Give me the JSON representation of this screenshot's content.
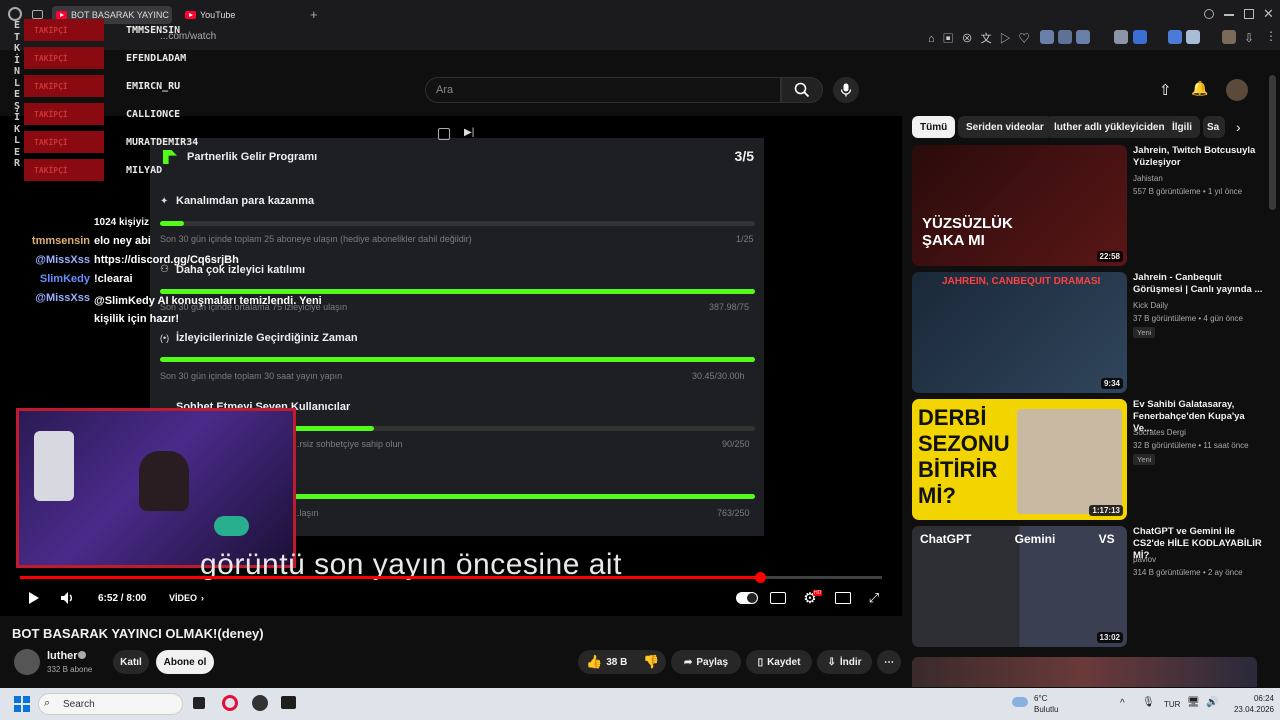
{
  "browser": {
    "tabs": [
      {
        "label": "BOT BASARAK YAYINC"
      },
      {
        "label": "YouTube"
      }
    ],
    "address": "...com/watch",
    "new_tab": "+"
  },
  "masthead": {
    "search_placeholder": "Ara"
  },
  "overlay": {
    "vertical_letters": [
      "E",
      "T",
      "K",
      "İ",
      "N",
      "L",
      "E",
      "Ş",
      "İ",
      "K",
      "L",
      "E",
      "R"
    ],
    "followers": [
      {
        "tag": "TAKİPÇİ",
        "name": "TMMSENSIN"
      },
      {
        "tag": "TAKİPÇİ",
        "name": "EFENDLADAM"
      },
      {
        "tag": "TAKİPÇİ",
        "name": "EMIRCN_RU"
      },
      {
        "tag": "TAKİPÇİ",
        "name": "CALLIONCE"
      },
      {
        "tag": "TAKİPÇİ",
        "name": "MURATDEMIR34"
      },
      {
        "tag": "TAKİPÇİ",
        "name": "MILYAD"
      }
    ],
    "chat": [
      {
        "user": "",
        "msg": "1024 kişiyiz",
        "color": "#ffffff"
      },
      {
        "user": "tmmsensin",
        "msg": "elo ney abi",
        "color": "#e0b070"
      },
      {
        "user": "@MissXss",
        "msg": "https://discord.gg/Cq6srjBh",
        "color": "#9ab0ff"
      },
      {
        "user": "SlimKedy",
        "msg": "!clearai",
        "color": "#6a8cff"
      },
      {
        "user": "@MissXss",
        "msg": "@SlimKedy AI konuşmaları temizlendi. Yeni kişilik için hazır!",
        "color": "#9ab0ff"
      }
    ],
    "subtitle": "görüntü son yayın öncesine ait"
  },
  "partner": {
    "title": "Partnerlik Gelir Programı",
    "count": "3/5",
    "sections": [
      {
        "heading": "Kanalımdan para kazanma",
        "desc": "Son 30 gün içinde toplam 25 aboneye ulaşın (hediye abonelikler dahil değildir)",
        "value": "1/25",
        "fill": 0.04
      },
      {
        "heading": "Daha çok izleyici katılımı",
        "desc": "Son 30 gün içinde ortalama 75 izleyiciye ulaşın",
        "value": "387.98/75",
        "fill": 1.0
      },
      {
        "heading": "İzleyicilerinizle Geçirdiğiniz Zaman",
        "desc": "Son 30 gün içinde toplam 30 saat yayın yapın",
        "value": "30.45/30.00h",
        "fill": 1.0
      },
      {
        "heading": "Sohbet Etmeyi Seven Kullanıcılar",
        "desc": "...rsiz sohbetçiye sahip olun",
        "value": "90/250",
        "fill": 0.36
      },
      {
        "heading": "",
        "desc": "...laşın",
        "value": "763/250",
        "fill": 1.0
      }
    ]
  },
  "player": {
    "time": "6:52 / 8:00",
    "chapter": "VİDEO",
    "progress": 0.858,
    "hd_badge": "HD"
  },
  "video": {
    "title": "BOT BASARAK YAYINCI OLMAK!(deney)",
    "channel": "luther",
    "subscribers": "332 B abone",
    "join": "Katıl",
    "subscribe": "Abone ol",
    "likes": "38 B",
    "share": "Paylaş",
    "save": "Kaydet",
    "download": "İndir"
  },
  "chips": [
    "Tümü",
    "Seriden videolar",
    "luther adlı yükleyiciden",
    "İlgili",
    "Sa"
  ],
  "recommended": [
    {
      "title": "Jahrein, Twitch Botcusuyla Yüzleşiyor",
      "channel": "Jahistan",
      "meta": "557 B görüntüleme • 1 yıl önce",
      "duration": "22:58",
      "badge": "",
      "thumb_text": "YÜZSÜZLÜK ŞAKA MI",
      "bg": "#3a1010"
    },
    {
      "title": "Jahrein - Canbequit Görüşmesi | Canlı yayında ...",
      "channel": "Kick Daily",
      "meta": "37 B görüntüleme • 4 gün önce",
      "duration": "9:34",
      "badge": "Yeni",
      "thumb_text": "JAHREIN, CANBEQUIT DRAMASI",
      "bg": "#1d2a3a"
    },
    {
      "title": "Ev Sahibi Galatasaray, Fenerbahçe'den Kupa'ya Ve...",
      "channel": "Socrates Dergi",
      "meta": "32 B görüntüleme • 11 saat önce",
      "duration": "1:17:13",
      "badge": "Yeni",
      "thumb_text": "DERBİ SEZONU BİTİRİR Mİ?",
      "bg": "#f1d400"
    },
    {
      "title": "ChatGPT ve Gemini ile CS2'de HİLE KODLAYABİLİR Mİ?",
      "channel": "pavlov",
      "meta": "314 B görüntüleme • 2 ay önce",
      "duration": "13:02",
      "badge": "",
      "thumb_text": "ChatGPT  Gemini  VS",
      "bg": "#2b2f3a"
    }
  ],
  "taskbar": {
    "search": "Search",
    "weather_temp": "6°C",
    "weather_desc": "Bulutlu",
    "lang": "TUR",
    "time": "06:24",
    "date": "23.04.2026"
  }
}
